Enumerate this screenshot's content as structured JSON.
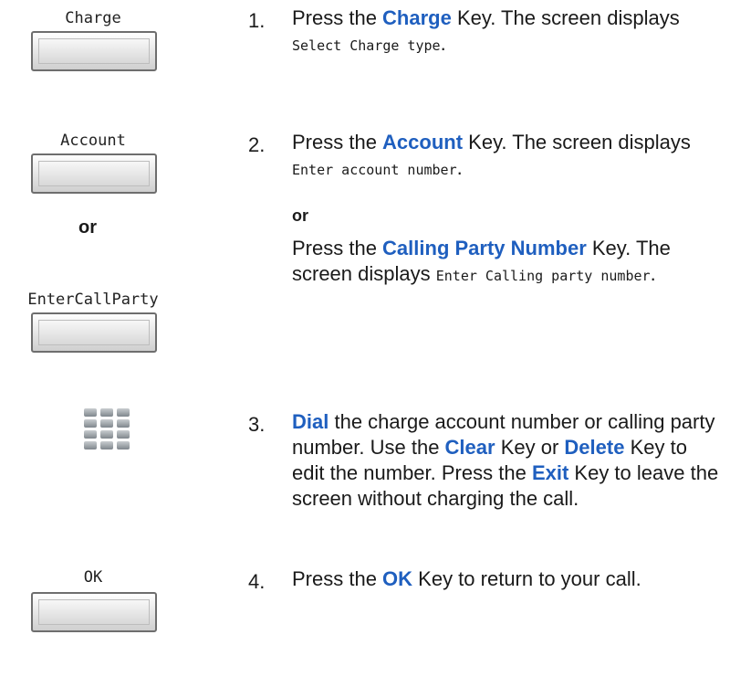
{
  "keys": {
    "charge": "Charge",
    "account": "Account",
    "enter_call_party": "EnterCallParty",
    "ok": "OK",
    "or": "or",
    "keypad_icon": "dial-pad-icon"
  },
  "steps": {
    "s1": {
      "num": "1.",
      "pre": "Press the ",
      "key": "Charge",
      "mid": " Key. The screen displays ",
      "screen": "Select Charge type",
      "end": "."
    },
    "s2": {
      "num": "2.",
      "pre": "Press the ",
      "key": "Account",
      "mid": " Key. The screen displays ",
      "screen": "Enter account number",
      "end": ".",
      "or": "or",
      "alt_pre": "Press the ",
      "alt_key": "Calling Party Number",
      "alt_mid": " Key. The screen displays ",
      "alt_screen": "Enter Calling party number",
      "alt_end": "."
    },
    "s3": {
      "num": "3.",
      "dial": "Dial",
      "a": " the charge account number or calling party number. Use the ",
      "clear": "Clear",
      "b": " Key or ",
      "delete": "Delete",
      "c": " Key to edit the number. Press the ",
      "exit": "Exit",
      "d": " Key to leave the screen without charging the call."
    },
    "s4": {
      "num": "4.",
      "pre": "Press the ",
      "key": "OK",
      "end": " Key to return to your call."
    }
  }
}
